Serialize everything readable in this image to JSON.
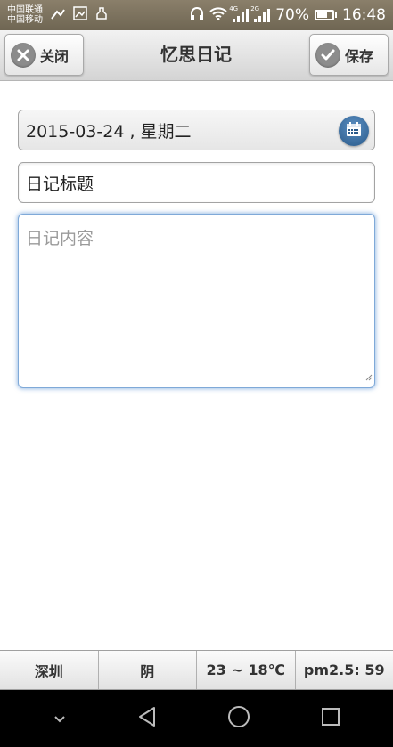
{
  "status_bar": {
    "carrier_1": "中国联通",
    "carrier_2": "中国移动",
    "signal_tag_1": "4G",
    "signal_tag_2": "2G",
    "battery": "70%",
    "battery_level": 0.7,
    "time": "16:48"
  },
  "header": {
    "title": "忆思日记",
    "close_label": "关闭",
    "save_label": "保存"
  },
  "form": {
    "date_value": "2015-03-24 , 星期二",
    "title_value": "日记标题",
    "content_placeholder": "日记内容"
  },
  "info_bar": {
    "city": "深圳",
    "weather": "阴",
    "temperature": "23 ~ 18℃",
    "pm25": "pm2.5: 59"
  },
  "icons": [
    "close-icon",
    "check-icon",
    "calendar-icon",
    "back-icon",
    "home-icon",
    "recents-icon",
    "chevron-down-icon",
    "wifi-icon",
    "headphones-icon",
    "battery-icon"
  ]
}
